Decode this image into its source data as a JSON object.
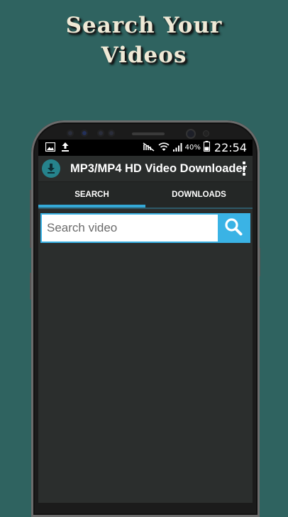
{
  "promo": {
    "line1": "Search Your",
    "line2": "Videos"
  },
  "status_bar": {
    "battery_percent": "40%",
    "time": "22:54"
  },
  "app_bar": {
    "title": "MP3/MP4 HD Video Downloader"
  },
  "tabs": [
    {
      "label": "SEARCH",
      "active": true
    },
    {
      "label": "DOWNLOADS",
      "active": false
    }
  ],
  "search": {
    "placeholder": "Search video",
    "value": ""
  },
  "colors": {
    "background": "#2f6360",
    "accent": "#3ab3e5",
    "logo": "#26838c",
    "screen": "#2b2e2d"
  },
  "icons": {
    "status_left": [
      "gallery-icon",
      "upload-icon"
    ],
    "status_right": [
      "mute-icon",
      "wifi-icon",
      "signal-icon",
      "battery-icon"
    ],
    "app_logo": "download-icon",
    "menu": "overflow-menu-icon",
    "search": "search-icon"
  }
}
